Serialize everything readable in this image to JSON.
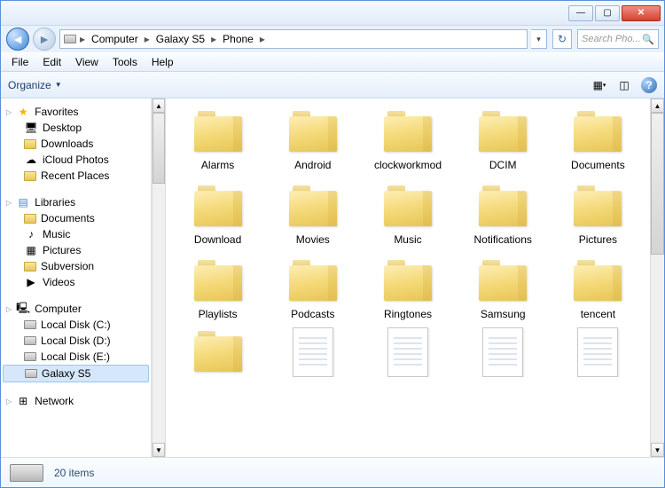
{
  "titlebar": {
    "min": "—",
    "max": "▢",
    "close": "✕"
  },
  "breadcrumbs": [
    "Computer",
    "Galaxy S5",
    "Phone"
  ],
  "search": {
    "placeholder": "Search Pho..."
  },
  "menu": [
    "File",
    "Edit",
    "View",
    "Tools",
    "Help"
  ],
  "toolbar": {
    "organize": "Organize"
  },
  "nav": {
    "favorites": {
      "label": "Favorites",
      "items": [
        "Desktop",
        "Downloads",
        "iCloud Photos",
        "Recent Places"
      ]
    },
    "libraries": {
      "label": "Libraries",
      "items": [
        "Documents",
        "Music",
        "Pictures",
        "Subversion",
        "Videos"
      ]
    },
    "computer": {
      "label": "Computer",
      "items": [
        "Local Disk (C:)",
        "Local Disk (D:)",
        "Local Disk (E:)",
        "Galaxy S5"
      ],
      "selected": 3
    },
    "network": {
      "label": "Network"
    }
  },
  "folders": [
    "Alarms",
    "Android",
    "clockworkmod",
    "DCIM",
    "Documents",
    "Download",
    "Movies",
    "Music",
    "Notifications",
    "Pictures",
    "Playlists",
    "Podcasts",
    "Ringtones",
    "Samsung",
    "tencent"
  ],
  "partial_row": [
    "folder",
    "file",
    "file",
    "file",
    "file"
  ],
  "status": {
    "count": "20 items"
  }
}
